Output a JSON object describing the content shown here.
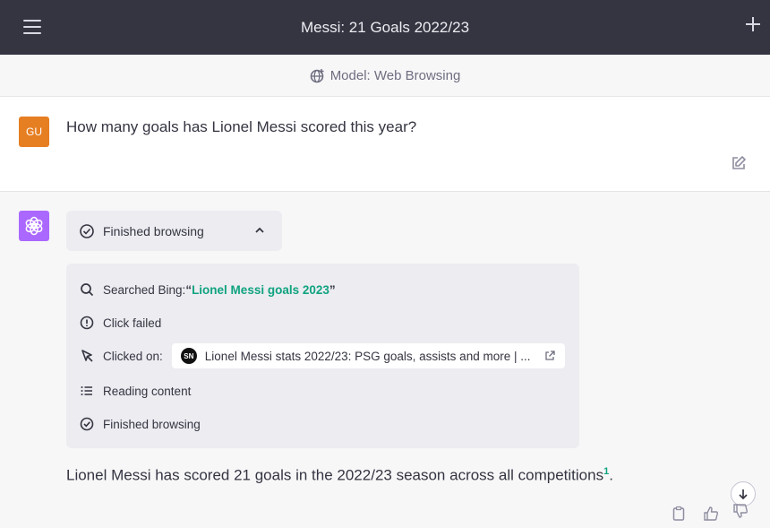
{
  "header": {
    "title": "Messi: 21 Goals 2022/23",
    "menu_icon": "hamburger-menu-icon",
    "new_chat_icon": "plus-icon"
  },
  "model_bar": {
    "label": "Model: Web Browsing",
    "icon": "globe-icon"
  },
  "user_message": {
    "avatar_initials": "GU",
    "avatar_color": "#e67e22",
    "text": "How many goals has Lionel Messi scored this year?"
  },
  "assistant": {
    "avatar_color": "#ab68ff",
    "browse_toggle_label": "Finished browsing",
    "steps": {
      "search_prefix": "Searched Bing: ",
      "search_query": "Lionel Messi goals 2023",
      "click_failed": "Click failed",
      "clicked_on_label": "Clicked on:",
      "clicked_link_logo": "SN",
      "clicked_link_title": "Lionel Messi stats 2022/23: PSG goals, assists and more | ...",
      "reading_content": "Reading content",
      "finished_browsing": "Finished browsing"
    },
    "answer_text": "Lionel Messi has scored 21 goals in the 2022/23 season across all competitions",
    "citation": "1",
    "answer_end": "."
  },
  "colors": {
    "topbar": "#343541",
    "accent": "#10a37f",
    "panel": "#ececf1"
  }
}
